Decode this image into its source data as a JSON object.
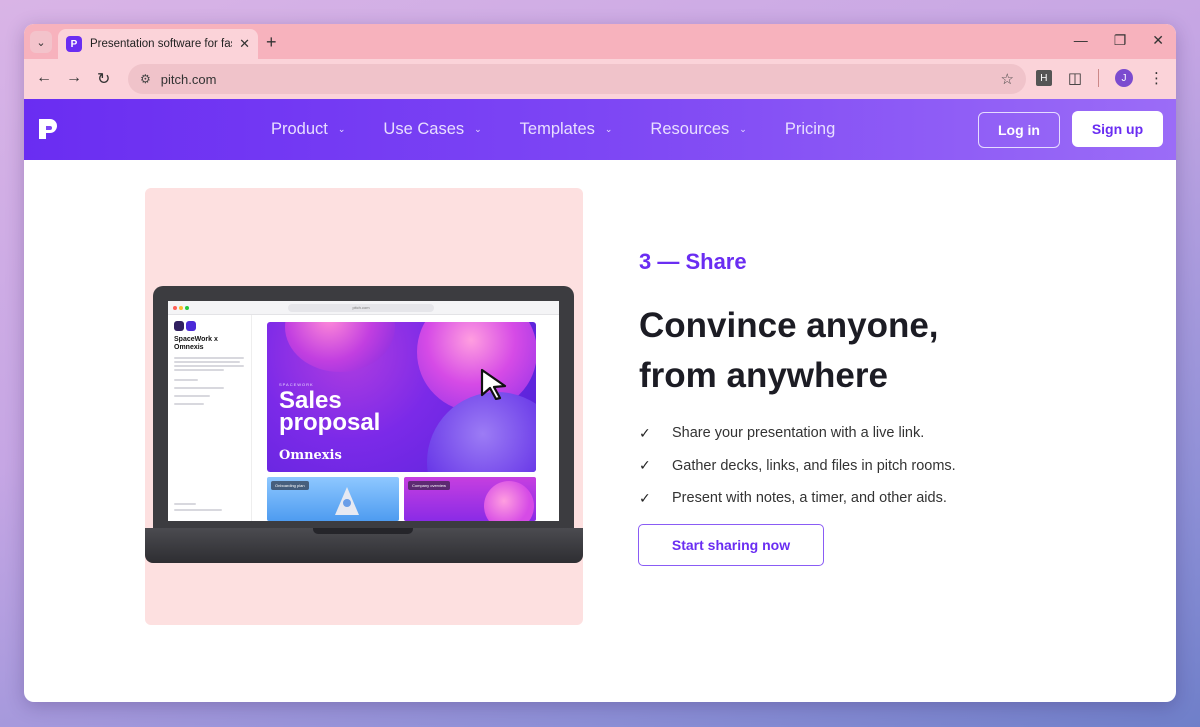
{
  "browser": {
    "tab_title": "Presentation software for fast-m",
    "url": "pitch.com",
    "profile_initial": "J",
    "extension_label": "H"
  },
  "nav": {
    "items": [
      {
        "label": "Product",
        "has_dropdown": true
      },
      {
        "label": "Use Cases",
        "has_dropdown": true
      },
      {
        "label": "Templates",
        "has_dropdown": true
      },
      {
        "label": "Resources",
        "has_dropdown": true
      },
      {
        "label": "Pricing",
        "has_dropdown": false
      }
    ],
    "login_label": "Log in",
    "signup_label": "Sign up"
  },
  "mockup": {
    "url": "pitch.com",
    "sidebar_title": "SpaceWork x Omnexis",
    "slide_kicker": "SPACEWORK",
    "slide_title": "Sales proposal",
    "slide_brand": "Omnexis",
    "thumb1_label": "Onboarding plan",
    "thumb2_label": "Company overview"
  },
  "content": {
    "step": "3 — Share",
    "headline_line1": "Convince anyone,",
    "headline_line2": "from anywhere",
    "bullets": [
      "Share your presentation with a live link.",
      "Gather decks, links, and files in pitch rooms.",
      "Present with notes, a timer, and other aids."
    ],
    "cta_label": "Start sharing now"
  },
  "colors": {
    "brand": "#6a2df2",
    "nav_gradient_end": "#9b6cf7",
    "panel_bg": "#fde0e0",
    "chrome_bg": "#fbd3d9"
  }
}
